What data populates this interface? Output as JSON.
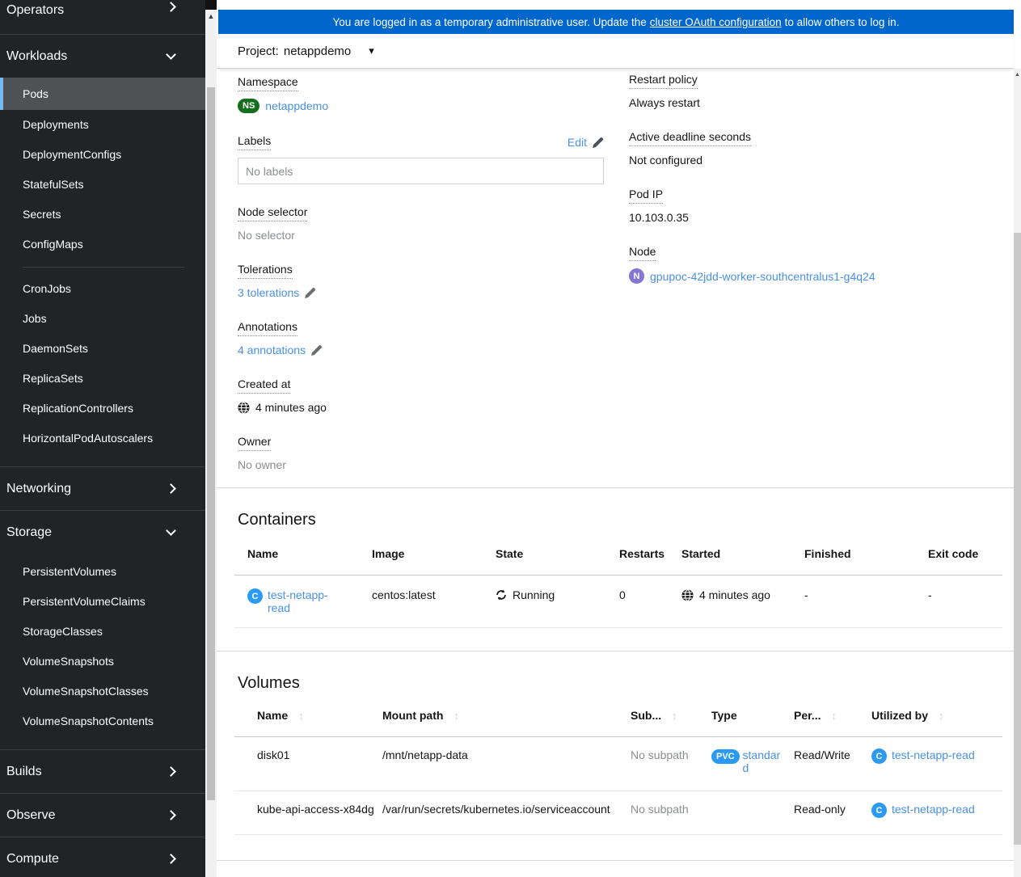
{
  "colors": {
    "banner_blue": "#0066cc",
    "sidebar_bg": "#212427",
    "sidebar_selected_bg": "#4f5255",
    "sidebar_selected_border": "#73bcf7",
    "link_blue": "#4a90e2",
    "badge_namespace_green": "#146e1e",
    "badge_container_blue": "#2b9af3",
    "badge_node_purple": "#8476d1",
    "muted_text": "#8a8d90"
  },
  "icons": {
    "sort": "↕",
    "caret_down": "▾",
    "scroll_up": "▲"
  },
  "banner": {
    "text_before": "You are logged in as a temporary administrative user. Update the",
    "link_text": "cluster OAuth configuration",
    "text_after": "to allow others to log in."
  },
  "project_bar": {
    "label": "Project:",
    "value": "netappdemo"
  },
  "sidebar": {
    "groups": [
      {
        "label": "Operators"
      },
      {
        "label": "Workloads"
      },
      {
        "label": "Networking"
      },
      {
        "label": "Storage"
      },
      {
        "label": "Builds"
      },
      {
        "label": "Observe"
      },
      {
        "label": "Compute"
      }
    ],
    "selected_item": "Pods",
    "workloads_items": [
      "Pods",
      "Deployments",
      "DeploymentConfigs",
      "StatefulSets",
      "Secrets",
      "ConfigMaps"
    ],
    "workloads_items2": [
      "CronJobs",
      "Jobs",
      "DaemonSets",
      "ReplicaSets",
      "ReplicationControllers",
      "HorizontalPodAutoscalers"
    ],
    "storage_items": [
      "PersistentVolumes",
      "PersistentVolumeClaims",
      "StorageClasses",
      "VolumeSnapshots",
      "VolumeSnapshotClasses",
      "VolumeSnapshotContents"
    ]
  },
  "details": {
    "namespace": {
      "label": "Namespace",
      "badge": "NS",
      "value": "netappdemo"
    },
    "labels": {
      "label": "Labels",
      "edit": "Edit",
      "empty": "No labels"
    },
    "node_selector": {
      "label": "Node selector",
      "value": "No selector"
    },
    "tolerations": {
      "label": "Tolerations",
      "link": "3 tolerations"
    },
    "annotations": {
      "label": "Annotations",
      "link": "4 annotations"
    },
    "created_at": {
      "label": "Created at",
      "value": "4 minutes ago"
    },
    "owner": {
      "label": "Owner",
      "value": "No owner"
    },
    "restart_policy": {
      "label": "Restart policy",
      "value": "Always restart"
    },
    "active_deadline": {
      "label": "Active deadline seconds",
      "value": "Not configured"
    },
    "pod_ip": {
      "label": "Pod IP",
      "value": "10.103.0.35"
    },
    "node": {
      "label": "Node",
      "badge": "N",
      "value": "gpupoc-42jdd-worker-southcentralus1-g4q24"
    }
  },
  "containers": {
    "title": "Containers",
    "columns": [
      "Name",
      "Image",
      "State",
      "Restarts",
      "Started",
      "Finished",
      "Exit code"
    ],
    "rows": [
      {
        "badge": "C",
        "name": "test-netapp-read",
        "image": "centos:latest",
        "state": "Running",
        "restarts": "0",
        "started": "4 minutes ago",
        "finished": "-",
        "exit_code": "-"
      }
    ]
  },
  "volumes": {
    "title": "Volumes",
    "columns": [
      "Name",
      "Mount path",
      "Sub...",
      "Type",
      "Per...",
      "Utilized by"
    ],
    "rows": [
      {
        "name": "disk01",
        "mount_path": "/mnt/netapp-data",
        "subpath": "No subpath",
        "type_badge": "PVC",
        "type_name": "standard",
        "permissions": "Read/Write",
        "utilized_badge": "C",
        "utilized_by": "test-netapp-read"
      },
      {
        "name": "kube-api-access-x84dg",
        "mount_path": "/var/run/secrets/kubernetes.io/serviceaccount",
        "subpath": "No subpath",
        "permissions": "Read-only",
        "utilized_badge": "C",
        "utilized_by": "test-netapp-read"
      }
    ]
  }
}
